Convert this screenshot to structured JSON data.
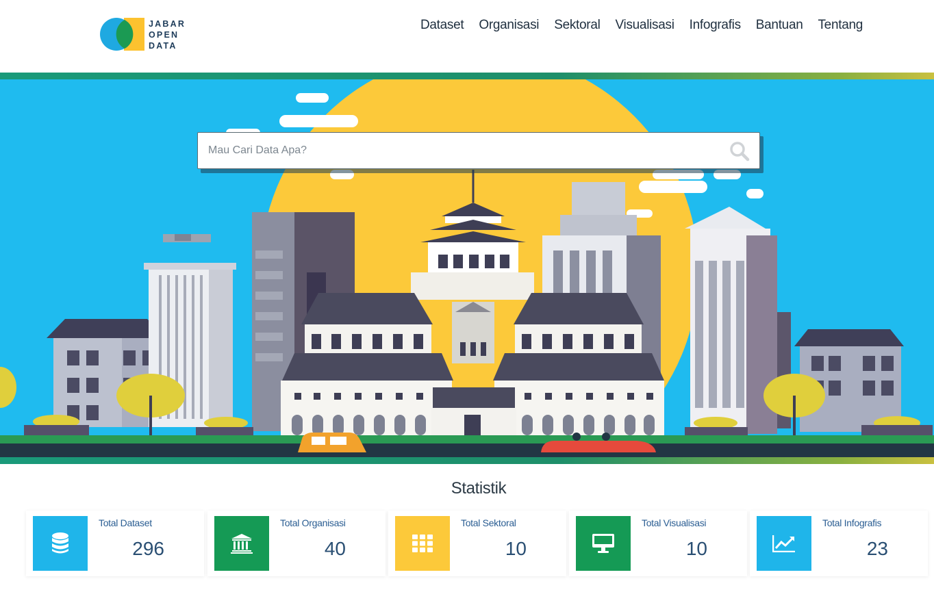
{
  "logo": {
    "lines": [
      "JABAR",
      "OPEN",
      "DATA"
    ],
    "icon": "jabar-open-data-logo"
  },
  "nav": {
    "items": [
      {
        "label": "Dataset"
      },
      {
        "label": "Organisasi"
      },
      {
        "label": "Sektoral"
      },
      {
        "label": "Visualisasi"
      },
      {
        "label": "Infografis"
      },
      {
        "label": "Bantuan"
      },
      {
        "label": "Tentang"
      }
    ]
  },
  "search": {
    "value": "",
    "placeholder": "Mau Cari Data Apa?",
    "icon": "search-icon"
  },
  "stats": {
    "title": "Statistik",
    "cards": [
      {
        "label": "Total Dataset",
        "value": "296",
        "icon": "database-icon",
        "color": "#1fb5ea"
      },
      {
        "label": "Total Organisasi",
        "value": "40",
        "icon": "institution-icon",
        "color": "#159a55"
      },
      {
        "label": "Total Sektoral",
        "value": "10",
        "icon": "grid-icon",
        "color": "#fcc93a"
      },
      {
        "label": "Total Visualisasi",
        "value": "10",
        "icon": "monitor-icon",
        "color": "#159a55"
      },
      {
        "label": "Total Infografis",
        "value": "23",
        "icon": "chart-line-icon",
        "color": "#1fb5ea"
      }
    ]
  },
  "colors": {
    "sky": "#1fbbef",
    "sun": "#fcc93a",
    "brand_green": "#159a55",
    "brand_blue": "#1fb5ea"
  }
}
